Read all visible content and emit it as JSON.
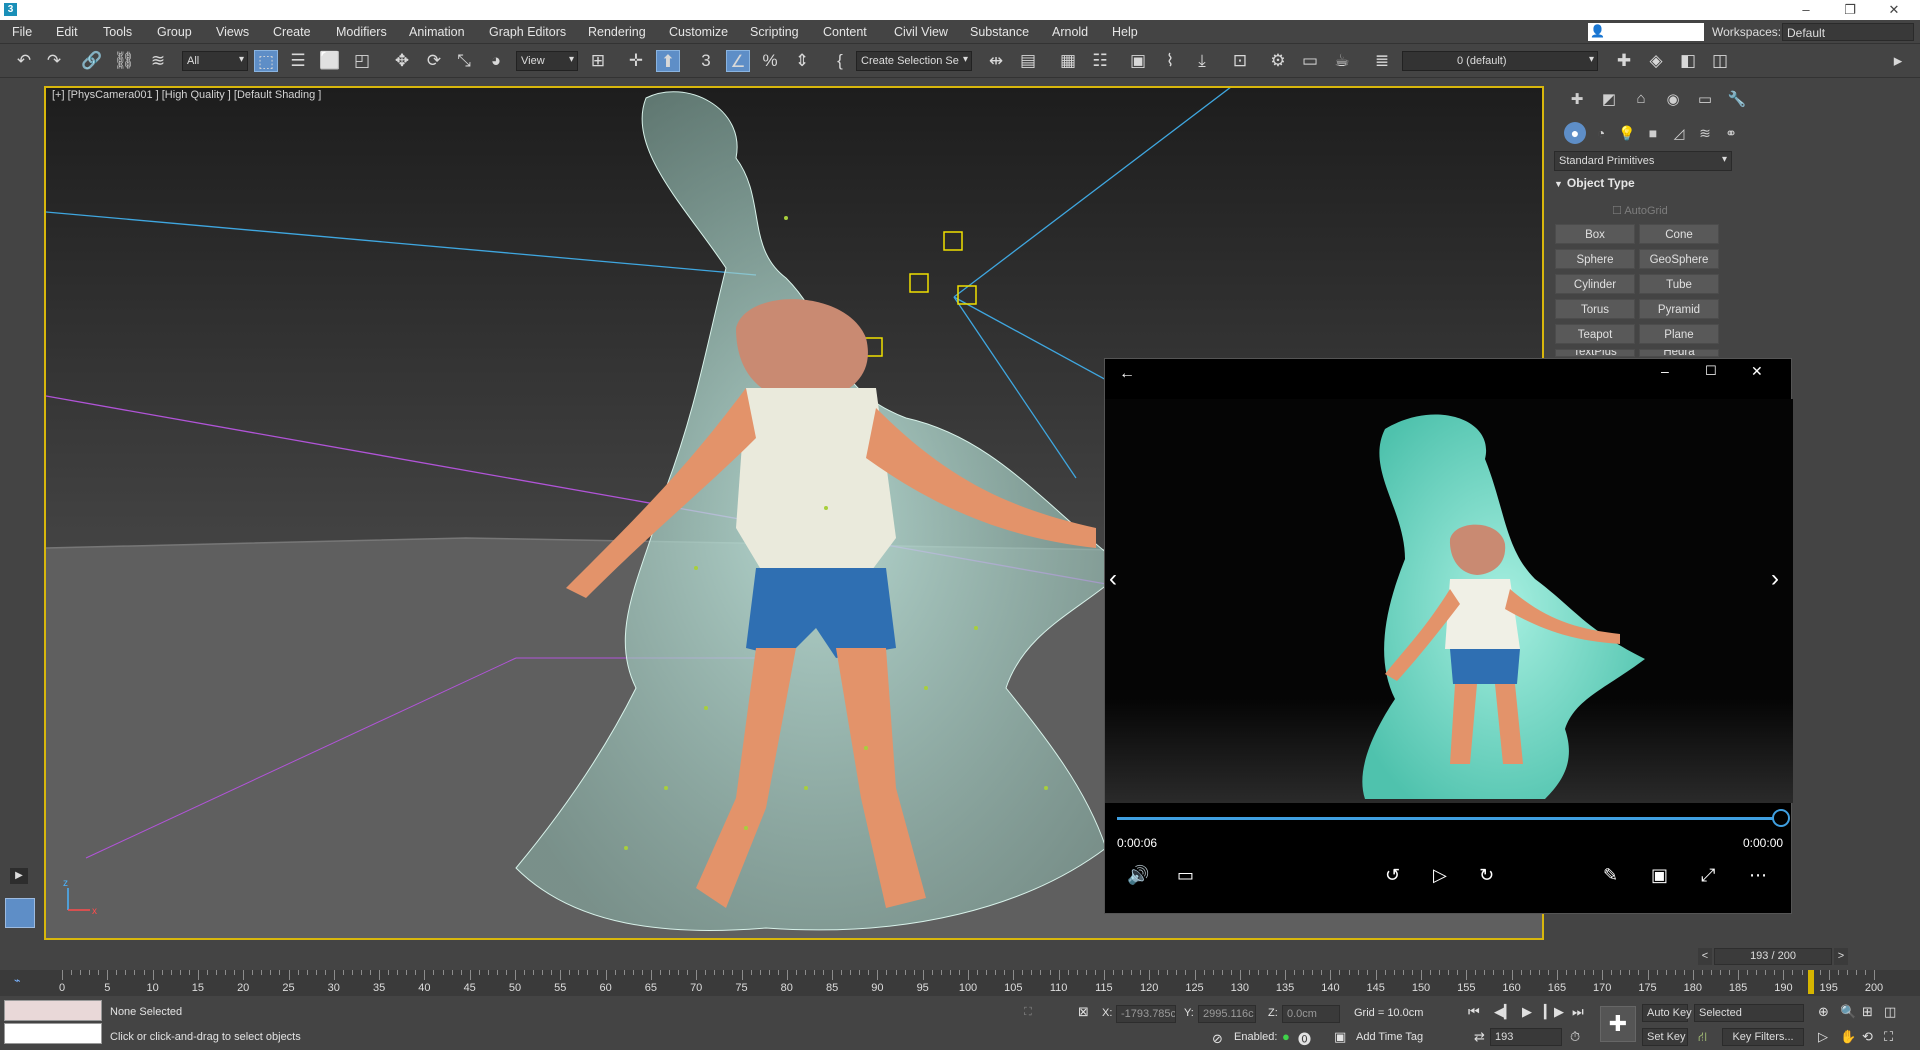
{
  "title_bar": {
    "app_icon": "3"
  },
  "window_controls": {
    "minimize": "–",
    "restore": "❐",
    "close": "✕"
  },
  "menu": {
    "items": [
      "File",
      "Edit",
      "Tools",
      "Group",
      "Views",
      "Create",
      "Modifiers",
      "Animation",
      "Graph Editors",
      "Rendering",
      "Customize",
      "Scripting",
      "Content",
      "Civil View",
      "Substance",
      "Arnold",
      "Help"
    ],
    "workspaces_label": "Workspaces:",
    "workspace_value": "Default"
  },
  "toolbar": {
    "selection_filter": "All",
    "reference_coord": "View",
    "named_selection": "Create Selection Se",
    "layer": "0 (default)"
  },
  "viewport": {
    "label": "[+] [PhysCamera001 ] [High Quality ] [Default Shading ]",
    "axis_x": "x",
    "axis_z": "z"
  },
  "command_panel": {
    "category": "Standard Primitives",
    "rollout_title": "Object Type",
    "autogrid": "AutoGrid",
    "primitives": [
      "Box",
      "Cone",
      "Sphere",
      "GeoSphere",
      "Cylinder",
      "Tube",
      "Torus",
      "Pyramid",
      "Teapot",
      "Plane",
      "TextPlus",
      "Hedra"
    ]
  },
  "timeline": {
    "frame_counter": "193 / 200",
    "current_frame": 193,
    "max_frame": 200,
    "prev_arrow": "<",
    "next_arrow": ">",
    "tick_labels": [
      "0",
      "5",
      "10",
      "15",
      "20",
      "25",
      "30",
      "35",
      "40",
      "45",
      "50",
      "55",
      "60",
      "65",
      "70",
      "75",
      "80",
      "85",
      "90",
      "95",
      "100",
      "105",
      "110",
      "115",
      "120",
      "125",
      "130",
      "135",
      "140",
      "145",
      "150",
      "155",
      "160",
      "165",
      "170",
      "175",
      "180",
      "185",
      "190",
      "195",
      "200"
    ]
  },
  "status_bar": {
    "selection": "None Selected",
    "prompt": "Click or click-and-drag to select objects",
    "x_label": "X:",
    "x_value": "-1793.785c",
    "y_label": "Y:",
    "y_value": "2995.116c",
    "z_label": "Z:",
    "z_value": "0.0cm",
    "grid": "Grid = 10.0cm",
    "enabled_label": "Enabled:",
    "add_time_tag": "Add Time Tag",
    "auto_key": "Auto Key",
    "set_key": "Set Key",
    "key_mode": "Selected",
    "key_filters": "Key Filters...",
    "frame_spinner": "193"
  },
  "media_player": {
    "current_time": "0:00:06",
    "remaining_time": "0:00:00",
    "progress": 1.0
  },
  "colors": {
    "viewport_border": "#d8b70c",
    "accent": "#5e8ec7",
    "progress": "#3f9fe0",
    "water": "#8fe0d0"
  }
}
